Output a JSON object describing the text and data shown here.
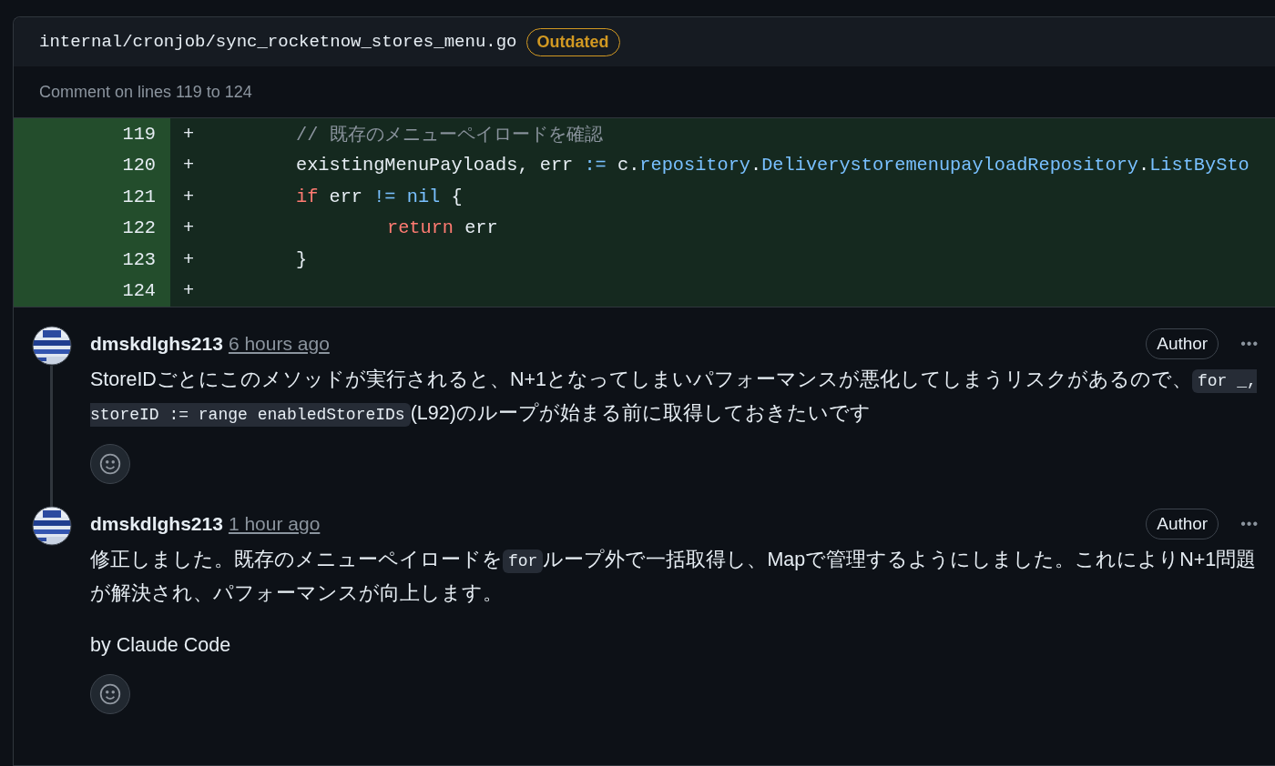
{
  "file_header": {
    "path": "internal/cronjob/sync_rocketnow_stores_menu.go",
    "badge": "Outdated"
  },
  "comment_range": "Comment on lines 119 to 124",
  "diff_lines": [
    {
      "number": "119",
      "sign": "+",
      "kind": "statement",
      "tokens": [
        {
          "kind": "comment",
          "text": "// 既存のメニューペイロードを確認"
        }
      ]
    },
    {
      "number": "120",
      "sign": "+",
      "kind": "statement",
      "tokens": [
        {
          "kind": "plain",
          "text": "existingMenuPayloads, err "
        },
        {
          "kind": "operator",
          "text": ":="
        },
        {
          "kind": "plain",
          "text": " c."
        },
        {
          "kind": "member",
          "text": "repository"
        },
        {
          "kind": "plain",
          "text": "."
        },
        {
          "kind": "member",
          "text": "DeliverystoremenupayloadRepository"
        },
        {
          "kind": "plain",
          "text": "."
        },
        {
          "kind": "member",
          "text": "ListBySto"
        }
      ]
    },
    {
      "number": "121",
      "sign": "+",
      "kind": "statement",
      "tokens": [
        {
          "kind": "keyword",
          "text": "if"
        },
        {
          "kind": "plain",
          "text": " err "
        },
        {
          "kind": "operator",
          "text": "!= nil"
        },
        {
          "kind": "plain",
          "text": " {"
        }
      ]
    },
    {
      "number": "122",
      "sign": "+",
      "kind": "nested",
      "tokens": [
        {
          "kind": "keyword",
          "text": "return"
        },
        {
          "kind": "plain",
          "text": " err"
        }
      ]
    },
    {
      "number": "123",
      "sign": "+",
      "kind": "statement",
      "tokens": [
        {
          "kind": "plain",
          "text": "}"
        }
      ]
    },
    {
      "number": "124",
      "sign": "+",
      "kind": "blank"
    }
  ],
  "comments": [
    {
      "author": "dmskdlghs213",
      "time": "6 hours ago",
      "badge": "Author",
      "more": "•••",
      "paragraphs": [
        [
          {
            "kind": "text",
            "text": "StoreIDごとにこのメソッドが実行されると、N+1となってしまいパフォーマンスが悪化してしまうリスクがあるので、"
          },
          {
            "kind": "code",
            "text": "for _, storeID := range enabledStoreIDs"
          },
          {
            "kind": "text",
            "text": "(L92)のループが始まる前に取得しておきたいです"
          }
        ]
      ]
    },
    {
      "author": "dmskdlghs213",
      "time": "1 hour ago",
      "badge": "Author",
      "more": "•••",
      "paragraphs": [
        [
          {
            "kind": "text",
            "text": "修正しました。既存のメニューペイロードを"
          },
          {
            "kind": "code",
            "text": "for"
          },
          {
            "kind": "text",
            "text": "ループ外で一括取得し、Mapで管理するようにしました。これによりN+1問題が解決され、パフォーマンスが向上します。"
          }
        ],
        [
          {
            "kind": "text",
            "text": "by Claude Code"
          }
        ]
      ]
    }
  ]
}
